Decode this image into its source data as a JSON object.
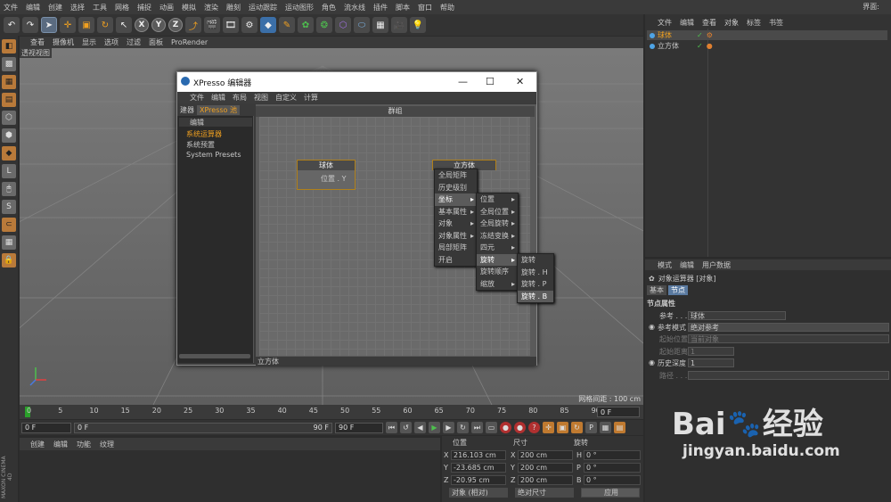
{
  "menubar": {
    "items": [
      "文件",
      "编辑",
      "创建",
      "选择",
      "工具",
      "网格",
      "捕捉",
      "动画",
      "模拟",
      "渲染",
      "雕刻",
      "运动跟踪",
      "运动图形",
      "角色",
      "流水线",
      "插件",
      "脚本",
      "窗口",
      "帮助"
    ],
    "layout_label": "界面:"
  },
  "toolbar": {
    "undo": "↶",
    "redo": "↷",
    "x": "X",
    "y": "Y",
    "z": "Z"
  },
  "viewbar": {
    "items": [
      "查看",
      "摄像机",
      "显示",
      "选项",
      "过滤",
      "面板",
      "ProRender"
    ]
  },
  "viewport": {
    "label": "透视视图",
    "grid_info": "网格间距 : 100 cm"
  },
  "timeline": {
    "ticks": [
      "0",
      "5",
      "10",
      "15",
      "20",
      "25",
      "30",
      "35",
      "40",
      "45",
      "50",
      "55",
      "60",
      "65",
      "70",
      "75",
      "80",
      "85",
      "90"
    ],
    "current": "0 F"
  },
  "transport": {
    "start": "0 F",
    "mid_left": "0 F",
    "mid_right": "90 F",
    "end": "90 F"
  },
  "material": {
    "menu": [
      "创建",
      "编辑",
      "功能",
      "纹理"
    ]
  },
  "coords": {
    "headers": [
      "位置",
      "尺寸",
      "旋转"
    ],
    "rows": [
      {
        "axis": "X",
        "pos": "216.103 cm",
        "saxis": "X",
        "size": "200 cm",
        "raxis": "H",
        "rot": "0 °"
      },
      {
        "axis": "Y",
        "pos": "-23.685 cm",
        "saxis": "Y",
        "size": "200 cm",
        "raxis": "P",
        "rot": "0 °"
      },
      {
        "axis": "Z",
        "pos": "-20.95 cm",
        "saxis": "Z",
        "size": "200 cm",
        "raxis": "B",
        "rot": "0 °"
      }
    ],
    "mode1": "对象 (相对)",
    "mode2": "绝对尺寸",
    "apply": "应用"
  },
  "objects": {
    "menu": [
      "文件",
      "编辑",
      "查看",
      "对象",
      "标签",
      "书签"
    ],
    "items": [
      "球体",
      "立方体"
    ]
  },
  "attributes": {
    "menu": [
      "模式",
      "编辑",
      "用户数据"
    ],
    "title": "对象运算器 [对象]",
    "tabs": [
      "基本",
      "节点"
    ],
    "section": "节点属性",
    "rows": [
      {
        "label": "参考 . . .",
        "value": "球体"
      },
      {
        "label": "参考模式",
        "value": "绝对参考"
      },
      {
        "label": "起始位置",
        "value": "当前对象"
      },
      {
        "label": "起始距离",
        "value": "1"
      },
      {
        "label": "历史深度",
        "value": "1"
      },
      {
        "label": "路径 . . . .",
        "value": ""
      }
    ]
  },
  "xpresso": {
    "title": "XPresso 编辑器",
    "min": "—",
    "max": "☐",
    "close": "✕",
    "menu": [
      "文件",
      "编辑",
      "布局",
      "视图",
      "自定义",
      "计算"
    ],
    "tabs": [
      "建器",
      "XPresso 池"
    ],
    "tree_header": "编辑",
    "tree": [
      "系统运算器",
      "系统预置",
      "System Presets"
    ],
    "group_label": "群组",
    "node1_title": "球体",
    "node1_port": "位置 . Y",
    "node2_title": "立方体",
    "status": "立方体"
  },
  "ctx_menu1": [
    "全局矩阵",
    "历史级别",
    "坐标",
    "基本属性",
    "对象",
    "对象属性",
    "局部矩阵",
    "开启"
  ],
  "ctx_menu2": [
    "位置",
    "全局位置",
    "全局旋转",
    "冻结变换",
    "四元",
    "旋转",
    "旋转顺序",
    "缩放"
  ],
  "ctx_menu3": [
    "旋转",
    "旋转 . H",
    "旋转 . P",
    "旋转 . B"
  ],
  "watermark": {
    "brand": "Bai",
    "brand2": "经验",
    "url": "jingyan.baidu.com"
  }
}
